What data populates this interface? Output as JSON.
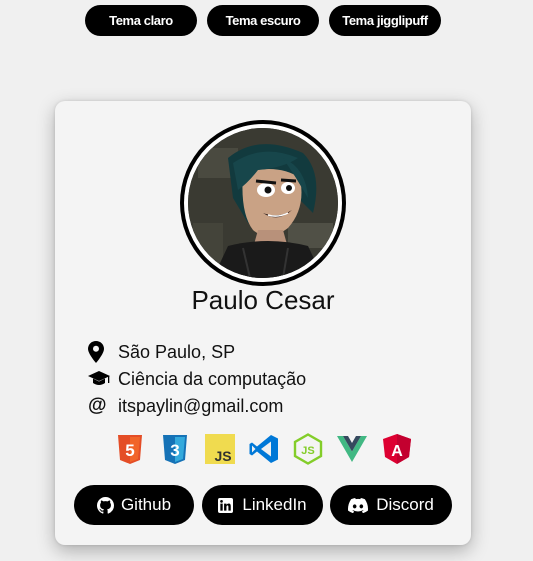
{
  "themes": [
    {
      "label": "Tema claro"
    },
    {
      "label": "Tema escuro"
    },
    {
      "label": "Tema jigglipuff"
    }
  ],
  "profile": {
    "name": "Paulo Cesar",
    "location": "São Paulo, SP",
    "education": "Ciência da computação",
    "email": "itspaylin@gmail.com"
  },
  "technologies": [
    {
      "icon": "html5-icon",
      "text": "5",
      "color": "#e44d26"
    },
    {
      "icon": "css3-icon",
      "text": "3",
      "color": "#1572b6"
    },
    {
      "icon": "javascript-icon",
      "text": "JS",
      "color": "#f0db4f"
    },
    {
      "icon": "vscode-icon",
      "color": "#0078d7"
    },
    {
      "icon": "nodejs-icon",
      "text": "JS",
      "color": "#83cd29"
    },
    {
      "icon": "vuejs-icon",
      "color": "#41b883"
    },
    {
      "icon": "angular-icon",
      "text": "A",
      "color": "#dd0031"
    }
  ],
  "social": [
    {
      "label": "Github",
      "icon": "github-icon"
    },
    {
      "label": "LinkedIn",
      "icon": "linkedin-icon"
    },
    {
      "label": "Discord",
      "icon": "discord-icon"
    }
  ]
}
